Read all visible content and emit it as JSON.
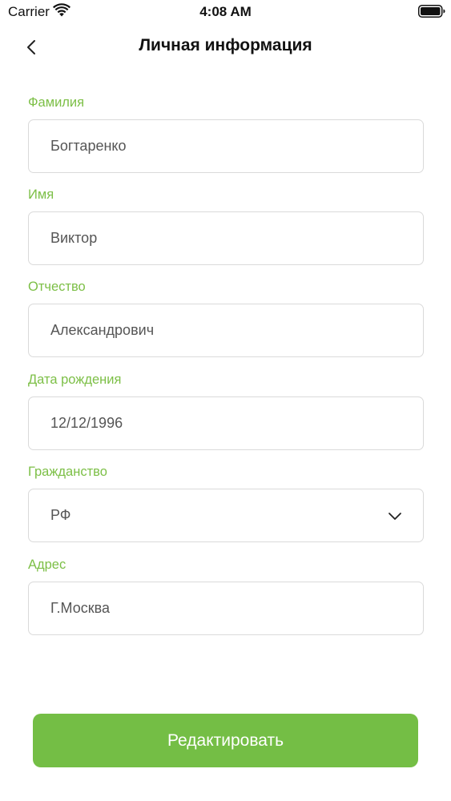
{
  "status_bar": {
    "carrier": "Carrier",
    "time": "4:08 AM",
    "icons": [
      "wifi-icon",
      "battery-icon"
    ]
  },
  "nav": {
    "title": "Личная информация",
    "back_icon": "chevron-left-icon"
  },
  "form": {
    "fields": [
      {
        "label": "Фамилия",
        "value": "Богтаренко"
      },
      {
        "label": "Имя",
        "value": "Виктор"
      },
      {
        "label": "Отчество",
        "value": "Александрович"
      },
      {
        "label": "Дата рождения",
        "value": "12/12/1996"
      },
      {
        "label": "Гражданство",
        "value": "РФ",
        "dropdown_icon": "chevron-down-icon"
      },
      {
        "label": "Адрес",
        "value": "Г.Москва"
      }
    ]
  },
  "actions": {
    "edit_label": "Редактировать"
  },
  "colors": {
    "accent": "#74be45",
    "label": "#7cbf46",
    "border": "#dadada",
    "value_text": "#555555"
  }
}
